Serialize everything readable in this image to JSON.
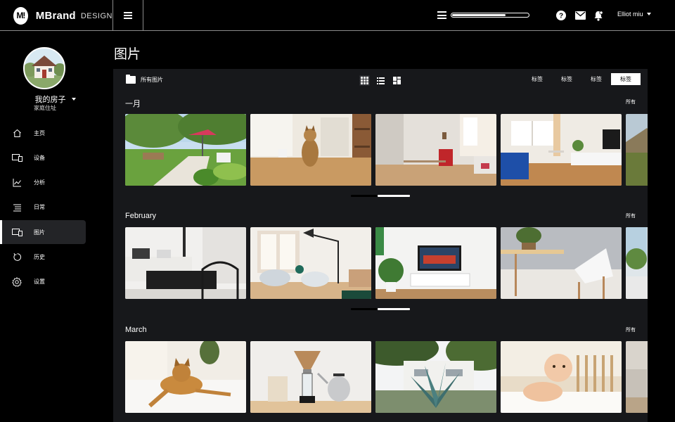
{
  "brand": {
    "logo": "M!",
    "name": "MBrand",
    "sub": "DESIGN"
  },
  "topbar": {
    "progress": 0.7,
    "user": "Elliot miu",
    "icons": [
      "list-icon",
      "help-icon",
      "mail-icon",
      "bell-icon"
    ]
  },
  "profile": {
    "name": "我的房子",
    "address": "家庭住址"
  },
  "nav": [
    {
      "label": "主页",
      "icon": "home-icon",
      "active": false
    },
    {
      "label": "设备",
      "icon": "devices-icon",
      "active": false
    },
    {
      "label": "分析",
      "icon": "chart-icon",
      "active": false
    },
    {
      "label": "日常",
      "icon": "list-icon",
      "active": false
    },
    {
      "label": "图片",
      "icon": "devices-icon",
      "active": true
    },
    {
      "label": "历史",
      "icon": "history-icon",
      "active": false
    },
    {
      "label": "设置",
      "icon": "gear-icon",
      "active": false
    }
  ],
  "page": {
    "title": "图片"
  },
  "panel": {
    "folder_label": "所有图片",
    "views": [
      "grid-view-icon",
      "list-view-icon",
      "mosaic-view-icon"
    ],
    "tags": [
      "标签",
      "标签",
      "标签",
      "标签"
    ],
    "sections": [
      {
        "title": "一月",
        "all_label": "所有",
        "photos": [
          "garden",
          "cat-kitchen",
          "living-room-red",
          "living-room-blue",
          "mountain"
        ]
      },
      {
        "title": "February",
        "all_label": "所有",
        "photos": [
          "bedroom-dark",
          "living-lamp",
          "tv-room",
          "dining-chairs",
          "bedroom-green"
        ]
      },
      {
        "title": "March",
        "all_label": "所有",
        "photos": [
          "cat-bed",
          "coffee",
          "agave-house",
          "baby",
          "room-partial"
        ]
      }
    ]
  },
  "colors": {
    "accent": "#ffffff",
    "panel": "#17181b",
    "active_nav": "#232427"
  }
}
